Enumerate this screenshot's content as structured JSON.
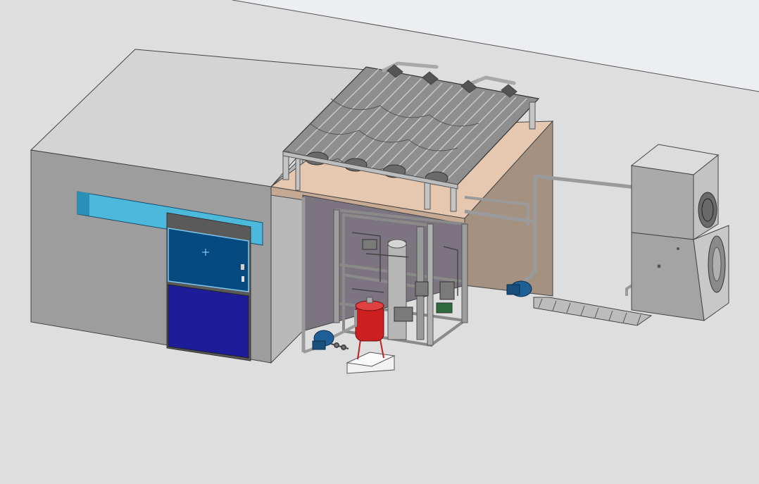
{
  "scene": {
    "background": "#dedede",
    "colors": {
      "wall_front": "#9c9c9c",
      "wall_top": "#d6d6d6",
      "wall_side": "#bdbdbd",
      "roof_slab": "#e6c8b1",
      "roof_side": "#a4917f",
      "door_glass": "#034a80",
      "door_panel": "#1d1d9a",
      "door_header": "#4cb8db",
      "frame": "#b4b4b4",
      "pipe": "#9a9a9a",
      "tank": "#cc1f1f",
      "pump": "#1e5f96"
    },
    "icons": {
      "selection_cursor": "crosshair-icon",
      "fan": "fan-icon"
    }
  }
}
